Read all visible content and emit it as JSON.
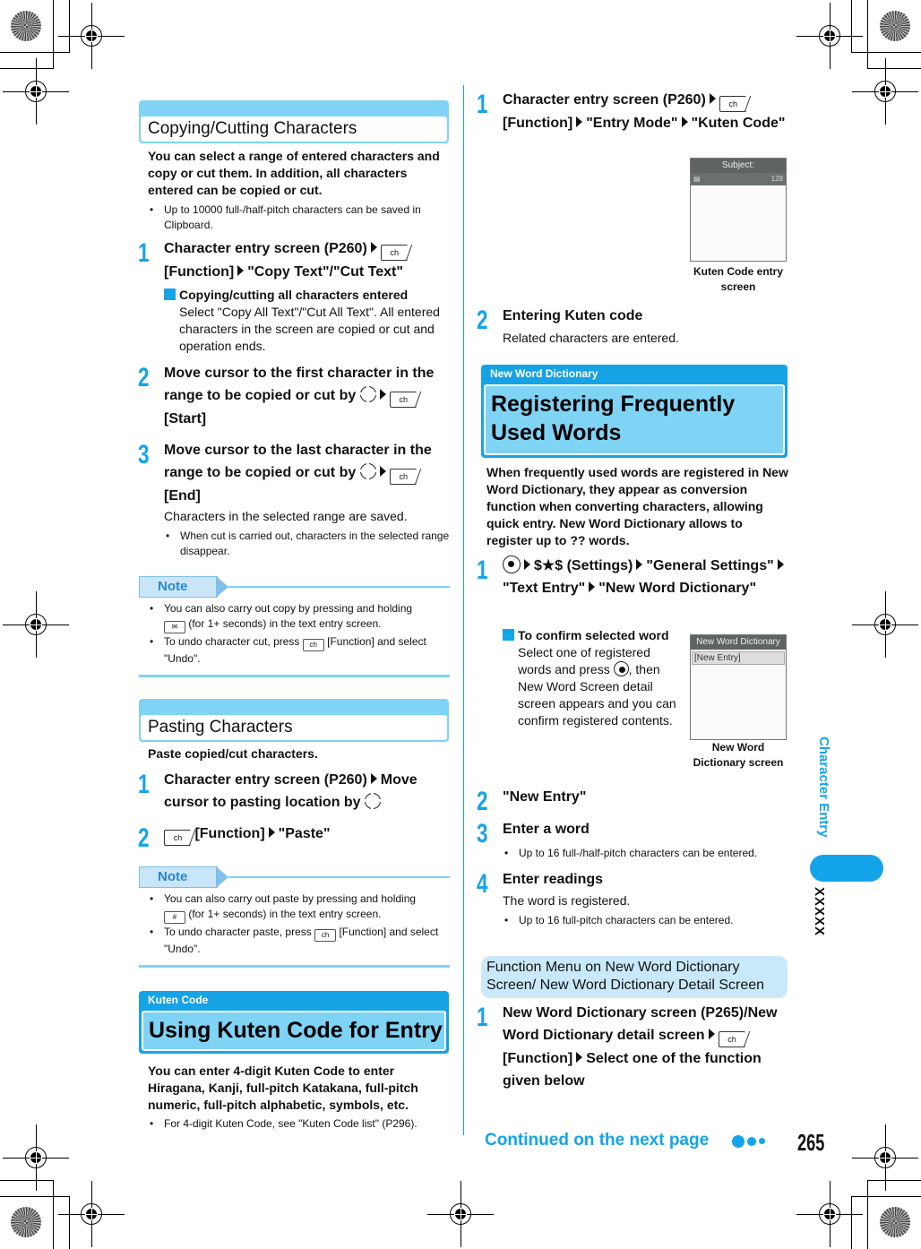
{
  "left": {
    "copy_section": {
      "title": "Copying/Cutting Characters",
      "lead": "You can select a range of entered characters and copy or cut them. In addition, all characters entered can be copied or cut.",
      "bullet": "Up to 10000 full-/half-pitch characters can be saved in Clipboard.",
      "steps": [
        {
          "num": "1",
          "parts": [
            "Character entry screen (P260)",
            "[Function]",
            "\"Copy Text\"/\"Cut Text\""
          ]
        },
        {
          "num": "2",
          "parts": [
            "Move cursor to the first character in the range to be copied or cut by",
            "[Start]"
          ]
        },
        {
          "num": "3",
          "parts": [
            "Move cursor to the last character in the range to be copied or cut by",
            "[End]"
          ]
        }
      ],
      "sub_heading": "Copying/cutting all characters entered",
      "sub_text": "Select \"Copy All Text\"/\"Cut All Text\". All entered characters in the screen are copied or cut and operation ends.",
      "step3_result": "Characters in the selected range are saved.",
      "step3_bullet": "When cut is carried out, characters in the selected range disappear.",
      "note_label": "Note",
      "notes": [
        {
          "a": "You can also carry out copy by pressing and holding",
          "b": "(for 1+ seconds) in the text entry screen."
        },
        {
          "a": "To undo character cut, press",
          "b": "[Function] and select \"Undo\"."
        }
      ]
    },
    "paste_section": {
      "title": "Pasting Characters",
      "lead": "Paste copied/cut characters.",
      "steps": [
        {
          "num": "1",
          "parts": [
            "Character entry screen (P260)",
            "Move cursor to pasting location by"
          ]
        },
        {
          "num": "2",
          "parts": [
            "[Function]",
            "\"Paste\""
          ]
        }
      ],
      "note_label": "Note",
      "notes": [
        {
          "a": "You can also carry out paste by pressing and holding",
          "b": "(for 1+ seconds) in the text entry screen."
        },
        {
          "a": "To undo character paste, press",
          "b": "[Function] and select \"Undo\"."
        }
      ]
    },
    "kuten_section": {
      "category": "Kuten Code",
      "title": "Using Kuten Code for Entry",
      "lead": "You can enter 4-digit Kuten Code to enter Hiragana, Kanji, full-pitch Katakana, full-pitch numeric, full-pitch alphabetic, symbols, etc.",
      "bullet": "For 4-digit Kuten Code, see \"Kuten Code list\" (P296)."
    }
  },
  "right": {
    "kuten_steps": [
      {
        "num": "1",
        "parts": [
          "Character entry screen (P260)",
          "[Function]",
          "\"Entry Mode\"",
          "\"Kuten Code\""
        ]
      },
      {
        "num": "2",
        "title": "Entering Kuten code",
        "text": "Related characters are entered."
      }
    ],
    "kuten_screen": {
      "title": "Subject:",
      "counter": "128",
      "caption": "Kuten Code entry screen"
    },
    "word_section": {
      "category": "New Word Dictionary",
      "title": "Registering Frequently Used Words",
      "lead": "When frequently used words are registered in New Word Dictionary, they appear as conversion function when converting characters, allowing quick entry. New Word Dictionary allows to register up to ?? words.",
      "step1_parts": [
        "$★$ (Settings)",
        "\"General Settings\"",
        "\"Text Entry\"",
        "\"New Word Dictionary\""
      ],
      "sub_heading": "To confirm selected word",
      "sub_text_a": "Select one of registered words and press",
      "sub_text_b": ", then New Word Screen detail screen appears and you can confirm registered contents.",
      "screen": {
        "title": "New Word Dictionary",
        "row": "[New Entry]",
        "caption": "New Word Dictionary screen"
      },
      "step2": "\"New Entry\"",
      "step3": "Enter a word",
      "step3_bullet": "Up to 16 full-/half-pitch characters can be entered.",
      "step4": "Enter readings",
      "step4_text": "The word is registered.",
      "step4_bullet": "Up to 16 full-pitch characters can be entered."
    },
    "func_section": {
      "title": "Function Menu on New Word Dictionary Screen/ New Word Dictionary Detail Screen",
      "step1_parts": [
        "New Word Dictionary screen (P265)/New Word Dictionary detail screen",
        "[Function]",
        "Select one of the function given below"
      ]
    }
  },
  "sidebar": {
    "label": "Character Entry",
    "code": "XXXXX"
  },
  "footer": {
    "continued": "Continued on the next page",
    "page_number": "265"
  },
  "keys": {
    "function_key": "ch",
    "center_key": "●"
  },
  "colors": {
    "accent": "#14a4ea",
    "header_light": "#7fd3f5",
    "func_bg": "#c9e9fa"
  }
}
